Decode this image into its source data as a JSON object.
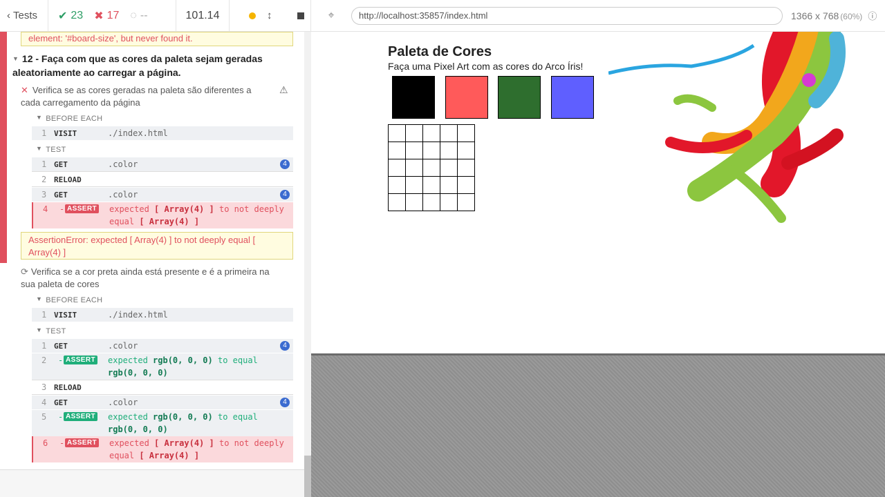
{
  "topbar": {
    "tests_label": "Tests",
    "passed": "23",
    "failed": "17",
    "pending": "--",
    "duration": "101.14"
  },
  "browser": {
    "url": "http://localhost:35857/index.html",
    "viewport": "1366 x 768",
    "zoom": "(60%)"
  },
  "reporter": {
    "error_prev": "element: '#board-size', but never found it.",
    "suite_title": "12 - Faça com que as cores da paleta sejam geradas aleatoriamente ao carregar a página.",
    "test1": {
      "title": "Verifica se as cores geradas na paleta são diferentes a cada carregamento da página",
      "before_each": "BEFORE EACH",
      "before": [
        {
          "n": "1",
          "name": "VISIT",
          "msg": "./index.html"
        }
      ],
      "test_label": "TEST",
      "commands": [
        {
          "n": "1",
          "name": "GET",
          "msg": ".color",
          "badge": "4"
        },
        {
          "n": "2",
          "name": "RELOAD",
          "msg": ""
        },
        {
          "n": "3",
          "name": "GET",
          "msg": ".color",
          "badge": "4"
        }
      ],
      "assert": {
        "n": "4",
        "dash": "-",
        "name": "ASSERT",
        "p1": "expected",
        "b1": "[ Array(4) ]",
        "p2": "to not deeply",
        "p3": "equal",
        "b2": "[ Array(4) ]"
      },
      "error": "AssertionError: expected [ Array(4) ] to not deeply equal [ Array(4) ]"
    },
    "test2": {
      "title": "Verifica se a cor preta ainda está presente e é a primeira na sua paleta de cores",
      "before_each": "BEFORE EACH",
      "before": [
        {
          "n": "1",
          "name": "VISIT",
          "msg": "./index.html"
        }
      ],
      "test_label": "TEST",
      "c1": {
        "n": "1",
        "name": "GET",
        "msg": ".color",
        "badge": "4"
      },
      "c2": {
        "n": "2",
        "dash": "-",
        "name": "ASSERT",
        "p1": "expected",
        "b1": "rgb(0, 0, 0)",
        "p2": "to equal",
        "b2": "rgb(0, 0, 0)"
      },
      "c3": {
        "n": "3",
        "name": "RELOAD"
      },
      "c4": {
        "n": "4",
        "name": "GET",
        "msg": ".color",
        "badge": "4"
      },
      "c5": {
        "n": "5",
        "dash": "-",
        "name": "ASSERT",
        "p1": "expected",
        "b1": "rgb(0, 0, 0)",
        "p2": "to equal",
        "b2": "rgb(0, 0, 0)"
      },
      "c6": {
        "n": "6",
        "dash": "-",
        "name": "ASSERT",
        "p1": "expected",
        "b1": "[ Array(4) ]",
        "p2": "to not deeply",
        "p3": "equal",
        "b2": "[ Array(4) ]"
      }
    }
  },
  "app": {
    "title": "Paleta de Cores",
    "subtitle": "Faça uma Pixel Art com as cores do Arco Íris!",
    "palette": [
      "#000000",
      "#ff5a5a",
      "#2e6e2e",
      "#5f5fff"
    ]
  }
}
